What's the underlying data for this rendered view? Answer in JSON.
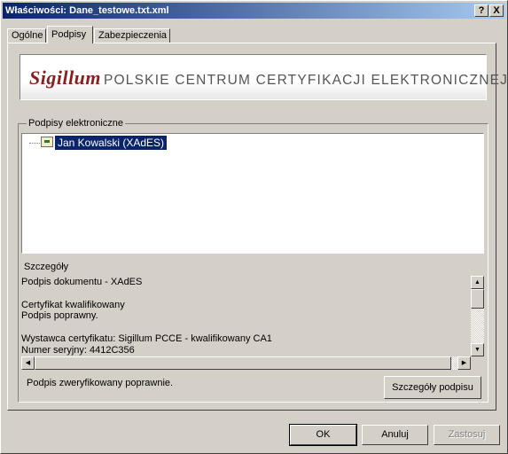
{
  "window": {
    "title": "Właściwości: Dane_testowe.txt.xml",
    "help_button": "?",
    "close_button": "X"
  },
  "tabs": [
    {
      "label": "Ogólne"
    },
    {
      "label": "Podpisy"
    },
    {
      "label": "Zabezpieczenia"
    }
  ],
  "banner": {
    "brand": "Sigillum",
    "tagline": "POLSKIE CENTRUM CERTYFIKACJI ELEKTRONICZNEJ"
  },
  "signatures": {
    "group_label": "Podpisy elektroniczne",
    "items": [
      {
        "label": "Jan Kowalski (XAdES)",
        "icon": "certificate-icon"
      }
    ]
  },
  "details": {
    "label": "Szczegóły",
    "lines": [
      "Podpis dokumentu - XAdES",
      "",
      "Certyfikat kwalifikowany",
      "Podpis poprawny.",
      "",
      "Wystawca certyfikatu: Sigillum PCCE - kwalifikowany CA1",
      "Numer seryjny: 4412C356"
    ]
  },
  "status_text": "Podpis zweryfikowany poprawnie.",
  "details_button": "Szczegóły podpisu",
  "footer": {
    "ok": "OK",
    "cancel": "Anuluj",
    "apply": "Zastosuj"
  }
}
